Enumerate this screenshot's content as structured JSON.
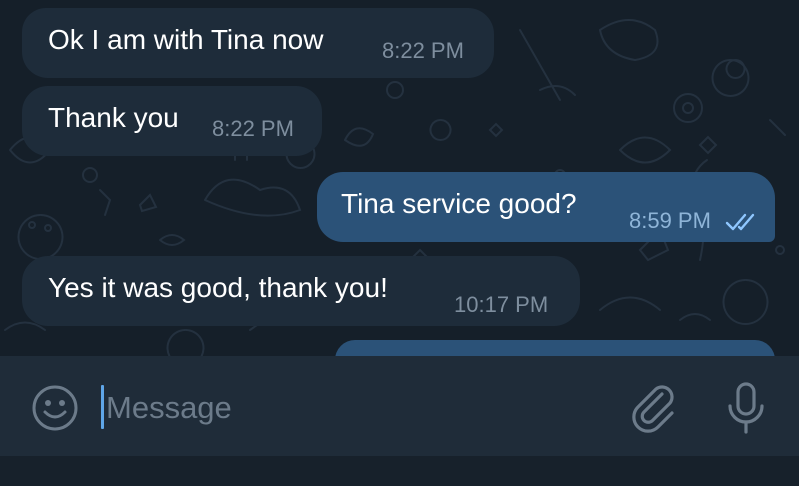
{
  "messages": [
    {
      "text": "Ok I am with Tina now",
      "time": "8:22 PM",
      "direction": "incoming"
    },
    {
      "text": "Thank you",
      "time": "8:22 PM",
      "direction": "incoming"
    },
    {
      "text": "Tina service good?",
      "time": "8:59 PM",
      "direction": "outgoing",
      "status": "read"
    },
    {
      "text": "Yes it was good, thank you!",
      "time": "10:17 PM",
      "direction": "incoming"
    }
  ],
  "composer": {
    "placeholder": "Message"
  },
  "icons": {
    "emoji": "emoji-icon",
    "attach": "paperclip-icon",
    "mic": "microphone-icon",
    "read_status": "double-check-icon"
  },
  "colors": {
    "chat_background": "#151f29",
    "incoming_bubble": "#1e2c3a",
    "outgoing_bubble": "#2b5278",
    "input_bar": "#1f2c39",
    "accent": "#5fa6e8"
  }
}
